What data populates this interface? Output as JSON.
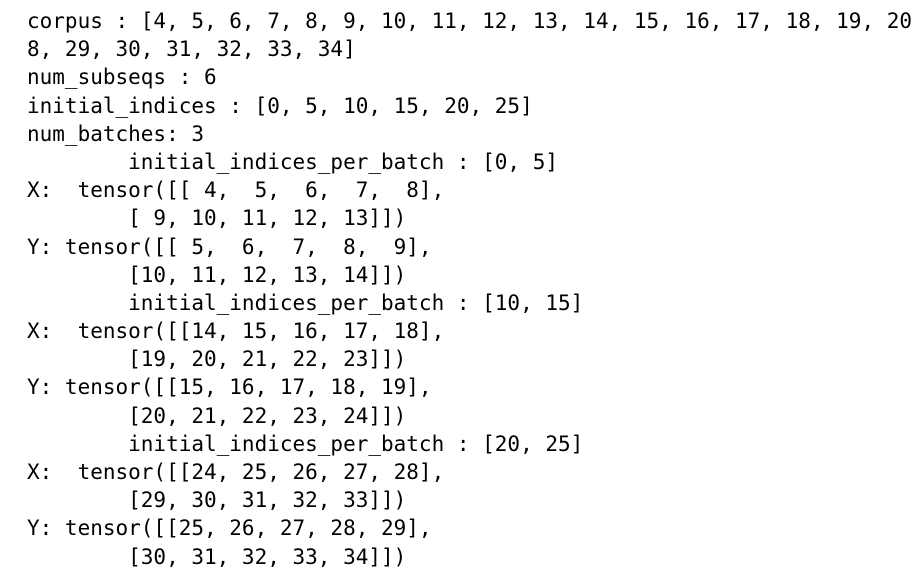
{
  "output_lines": [
    "corpus : [4, 5, 6, 7, 8, 9, 10, 11, 12, 13, 14, 15, 16, 17, 18, 19, 20",
    "8, 29, 30, 31, 32, 33, 34]",
    "num_subseqs : 6",
    "initial_indices : [0, 5, 10, 15, 20, 25]",
    "num_batches: 3",
    "        initial_indices_per_batch : [0, 5]",
    "X:  tensor([[ 4,  5,  6,  7,  8],",
    "        [ 9, 10, 11, 12, 13]])",
    "Y: tensor([[ 5,  6,  7,  8,  9],",
    "        [10, 11, 12, 13, 14]])",
    "        initial_indices_per_batch : [10, 15]",
    "X:  tensor([[14, 15, 16, 17, 18],",
    "        [19, 20, 21, 22, 23]])",
    "Y: tensor([[15, 16, 17, 18, 19],",
    "        [20, 21, 22, 23, 24]])",
    "        initial_indices_per_batch : [20, 25]",
    "X:  tensor([[24, 25, 26, 27, 28],",
    "        [29, 30, 31, 32, 33]])",
    "Y: tensor([[25, 26, 27, 28, 29],",
    "        [30, 31, 32, 33, 34]])"
  ]
}
